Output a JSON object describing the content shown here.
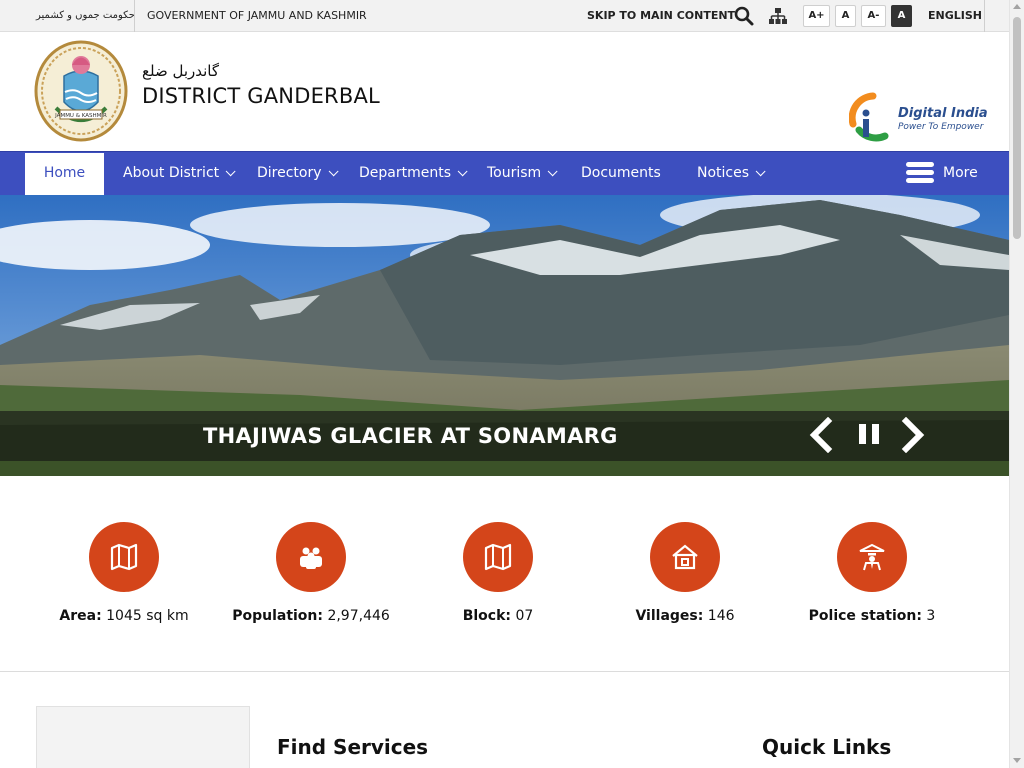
{
  "topbar": {
    "gov_urdu": "حکومت جموں و کشمیر",
    "gov_english": "GOVERNMENT OF JAMMU AND KASHMIR",
    "skip_link": "SKIP TO MAIN CONTENT",
    "search_icon": "search-icon",
    "sitemap_icon": "sitemap-icon",
    "font_increase": "A+",
    "font_normal": "A",
    "font_decrease": "A-",
    "high_contrast": "A",
    "language": "ENGLISH"
  },
  "header": {
    "district_urdu": "گاندربل ضلع",
    "district_name": "DISTRICT GANDERBAL",
    "emblem_text": "JAMMU & KASHMIR",
    "digital_india_title": "Digital India",
    "digital_india_tagline": "Power To Empower"
  },
  "nav": {
    "home": "Home",
    "items": [
      {
        "label": "About District",
        "has_dropdown": true
      },
      {
        "label": "Directory",
        "has_dropdown": true
      },
      {
        "label": "Departments",
        "has_dropdown": true
      },
      {
        "label": "Tourism",
        "has_dropdown": true
      },
      {
        "label": "Documents",
        "has_dropdown": false
      },
      {
        "label": "Notices",
        "has_dropdown": true
      }
    ],
    "more": "More"
  },
  "slider": {
    "caption": "THAJIWAS GLACIER AT SONAMARG",
    "prev_icon": "chevron-left-icon",
    "pause_icon": "pause-icon",
    "next_icon": "chevron-right-icon"
  },
  "stats": [
    {
      "key": "Area:",
      "value": "1045 sq km",
      "icon": "map-icon"
    },
    {
      "key": "Population:",
      "value": "2,97,446",
      "icon": "people-icon"
    },
    {
      "key": "Block:",
      "value": "07",
      "icon": "map-icon"
    },
    {
      "key": "Villages:",
      "value": "146",
      "icon": "house-icon"
    },
    {
      "key": "Police station:",
      "value": "3",
      "icon": "police-icon"
    }
  ],
  "sections": {
    "find_services": "Find Services",
    "quick_links": "Quick Links"
  },
  "colors": {
    "nav_bg": "#3d4fbf",
    "stat_circle": "#d4451a",
    "topbar_bg": "#f2f2f2"
  }
}
